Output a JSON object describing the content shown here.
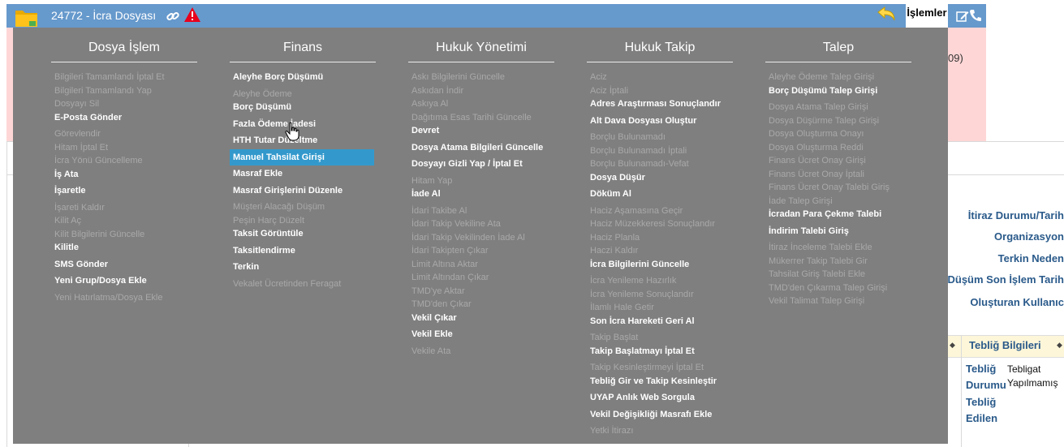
{
  "header": {
    "title": "24772 - İcra Dosyası",
    "islemler_label": "İşlemler"
  },
  "background": {
    "pink_text": "09)",
    "right_labels": [
      {
        "text": "İtiraz Durumu/Tarih"
      },
      {
        "text": "Organizasyon"
      },
      {
        "text": "Terkin Neden"
      },
      {
        "text": "Düşüm Son İşlem Tarih"
      },
      {
        "text": "Oluşturan Kullanıc"
      }
    ],
    "grid": {
      "column_header": "Tebliğ Bilgileri",
      "row": {
        "label1": "Tebliğ Durumu",
        "value1": "Tebligat Yapılmamış",
        "label2": "Tebliğ Edilen"
      }
    }
  },
  "menu": {
    "selected_item": "Manuel Tahsilat Girişi",
    "columns": [
      {
        "title": "Dosya İşlem",
        "items": [
          {
            "label": "Bilgileri Tamamlandı İptal Et",
            "enabled": false
          },
          {
            "label": "Bilgileri Tamamlandı Yap",
            "enabled": false
          },
          {
            "label": "Dosyayı Sil",
            "enabled": false
          },
          {
            "label": "E-Posta Gönder",
            "enabled": true
          },
          {
            "label": "Görevlendir",
            "enabled": false
          },
          {
            "label": "Hitam İptal Et",
            "enabled": false
          },
          {
            "label": "İcra Yönü Güncelleme",
            "enabled": false
          },
          {
            "label": "İş Ata",
            "enabled": true
          },
          {
            "label": "İşaretle",
            "enabled": true
          },
          {
            "label": "İşareti Kaldır",
            "enabled": false
          },
          {
            "label": "Kilit Aç",
            "enabled": false
          },
          {
            "label": "Kilit Bilgilerini Güncelle",
            "enabled": false
          },
          {
            "label": "Kilitle",
            "enabled": true
          },
          {
            "label": "SMS Gönder",
            "enabled": true
          },
          {
            "label": "Yeni Grup/Dosya Ekle",
            "enabled": true
          },
          {
            "label": "Yeni Hatırlatma/Dosya Ekle",
            "enabled": false
          }
        ]
      },
      {
        "title": "Finans",
        "items": [
          {
            "label": "Aleyhe Borç Düşümü",
            "enabled": true
          },
          {
            "label": "Aleyhe Ödeme",
            "enabled": false
          },
          {
            "label": "Borç Düşümü",
            "enabled": true
          },
          {
            "label": "Fazla Ödeme İadesi",
            "enabled": true
          },
          {
            "label": "HTH Tutar Düzeltme",
            "enabled": true
          },
          {
            "label": "Manuel Tahsilat Girişi",
            "enabled": true
          },
          {
            "label": "Masraf Ekle",
            "enabled": true
          },
          {
            "label": "Masraf Girişlerini Düzenle",
            "enabled": true
          },
          {
            "label": "Müşteri Alacağı Düşüm",
            "enabled": false
          },
          {
            "label": "Peşin Harç Düzelt",
            "enabled": false
          },
          {
            "label": "Taksit Görüntüle",
            "enabled": true
          },
          {
            "label": "Taksitlendirme",
            "enabled": true
          },
          {
            "label": "Terkin",
            "enabled": true
          },
          {
            "label": "Vekalet Ücretinden Feragat",
            "enabled": false
          }
        ]
      },
      {
        "title": "Hukuk Yönetimi",
        "items": [
          {
            "label": "Askı Bilgilerini Güncelle",
            "enabled": false
          },
          {
            "label": "Askıdan İndir",
            "enabled": false
          },
          {
            "label": "Askıya Al",
            "enabled": false
          },
          {
            "label": "Dağıtıma Esas Tarihi Güncelle",
            "enabled": false
          },
          {
            "label": "Devret",
            "enabled": true
          },
          {
            "label": "Dosya Atama Bilgileri Güncelle",
            "enabled": true
          },
          {
            "label": "Dosyayı Gizli Yap / İptal Et",
            "enabled": true
          },
          {
            "label": "Hitam Yap",
            "enabled": false
          },
          {
            "label": "İade Al",
            "enabled": true
          },
          {
            "label": "İdari Takibe Al",
            "enabled": false
          },
          {
            "label": "İdari Takip Vekiline Ata",
            "enabled": false
          },
          {
            "label": "İdari Takip Vekilinden İade Al",
            "enabled": false
          },
          {
            "label": "İdari Takipten Çıkar",
            "enabled": false
          },
          {
            "label": "Limit Altına Aktar",
            "enabled": false
          },
          {
            "label": "Limit Altından Çıkar",
            "enabled": false
          },
          {
            "label": "TMD'ye Aktar",
            "enabled": false
          },
          {
            "label": "TMD'den Çıkar",
            "enabled": false
          },
          {
            "label": "Vekil Çıkar",
            "enabled": true
          },
          {
            "label": "Vekil Ekle",
            "enabled": true
          },
          {
            "label": "Vekile Ata",
            "enabled": false
          }
        ]
      },
      {
        "title": "Hukuk Takip",
        "items": [
          {
            "label": "Aciz",
            "enabled": false
          },
          {
            "label": "Aciz İptali",
            "enabled": false
          },
          {
            "label": "Adres Araştırması Sonuçlandır",
            "enabled": true
          },
          {
            "label": "Alt Dava Dosyası Oluştur",
            "enabled": true
          },
          {
            "label": "Borçlu Bulunamadı",
            "enabled": false
          },
          {
            "label": "Borçlu Bulunamadı İptali",
            "enabled": false
          },
          {
            "label": "Borçlu Bulunamadı-Vefat",
            "enabled": false
          },
          {
            "label": "Dosya Düşür",
            "enabled": true
          },
          {
            "label": "Döküm Al",
            "enabled": true
          },
          {
            "label": "Haciz Aşamasına Geçir",
            "enabled": false
          },
          {
            "label": "Haciz Müzekkeresi Sonuçlandır",
            "enabled": false
          },
          {
            "label": "Haciz Planla",
            "enabled": false
          },
          {
            "label": "Haczi Kaldır",
            "enabled": false
          },
          {
            "label": "İcra Bilgilerini Güncelle",
            "enabled": true
          },
          {
            "label": "İcra Yenileme Hazırlık",
            "enabled": false
          },
          {
            "label": "İcra Yenileme Sonuçlandır",
            "enabled": false
          },
          {
            "label": "İlamlı Hale Getir",
            "enabled": false
          },
          {
            "label": "Son İcra Hareketi Geri Al",
            "enabled": true
          },
          {
            "label": "Takip Başlat",
            "enabled": false
          },
          {
            "label": "Takip Başlatmayı İptal Et",
            "enabled": true
          },
          {
            "label": "Takip Kesinleştirmeyi İptal Et",
            "enabled": false
          },
          {
            "label": "Tebliğ Gir ve Takip Kesinleştir",
            "enabled": true
          },
          {
            "label": "UYAP Anlık Web Sorgula",
            "enabled": true
          },
          {
            "label": "Vekil Değişikliği Masrafı Ekle",
            "enabled": true
          },
          {
            "label": "Yetki İtirazı",
            "enabled": false
          }
        ]
      },
      {
        "title": "Talep",
        "items": [
          {
            "label": "Aleyhe Ödeme Talep Girişi",
            "enabled": false
          },
          {
            "label": "Borç Düşümü Talep Girişi",
            "enabled": true
          },
          {
            "label": "Dosya Atama Talep Girişi",
            "enabled": false
          },
          {
            "label": "Dosya Düşürme Talep Girişi",
            "enabled": false
          },
          {
            "label": "Dosya Oluşturma Onayı",
            "enabled": false
          },
          {
            "label": "Dosya Oluşturma Reddi",
            "enabled": false
          },
          {
            "label": "Finans Ücret Onay Girişi",
            "enabled": false
          },
          {
            "label": "Finans Ücret Onay İptali",
            "enabled": false
          },
          {
            "label": "Finans Ücret Onay Talebi Giriş",
            "enabled": false
          },
          {
            "label": "İade Talep Girişi",
            "enabled": false
          },
          {
            "label": "İcradan Para Çekme Talebi",
            "enabled": true
          },
          {
            "label": "İndirim Talebi Giriş",
            "enabled": true
          },
          {
            "label": "İtiraz İnceleme Talebi Ekle",
            "enabled": false
          },
          {
            "label": "Mükerrer Takip Talebi Gir",
            "enabled": false
          },
          {
            "label": "Tahsilat Giriş Talebi Ekle",
            "enabled": false
          },
          {
            "label": "TMD'den Çıkarma Talep Girişi",
            "enabled": false
          },
          {
            "label": "Vekil Talimat Talep Girişi",
            "enabled": false
          }
        ]
      }
    ]
  }
}
